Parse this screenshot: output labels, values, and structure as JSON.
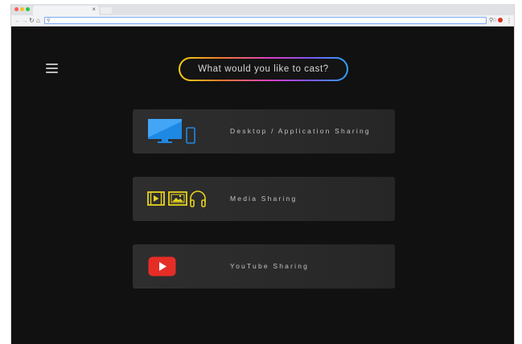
{
  "page": {
    "title": "What would you like to cast?"
  },
  "options": [
    {
      "label": "Desktop / Application Sharing",
      "icon": "desktop-and-phone-icon"
    },
    {
      "label": "Media Sharing",
      "icon": "media-icons"
    },
    {
      "label": "YouTube Sharing",
      "icon": "youtube-icon"
    }
  ],
  "colors": {
    "background": "#111111",
    "card": "#2b2b2b",
    "desktop_icon": "#1e88e5",
    "media_icon": "#e6d21f",
    "youtube_red": "#e52d27"
  }
}
